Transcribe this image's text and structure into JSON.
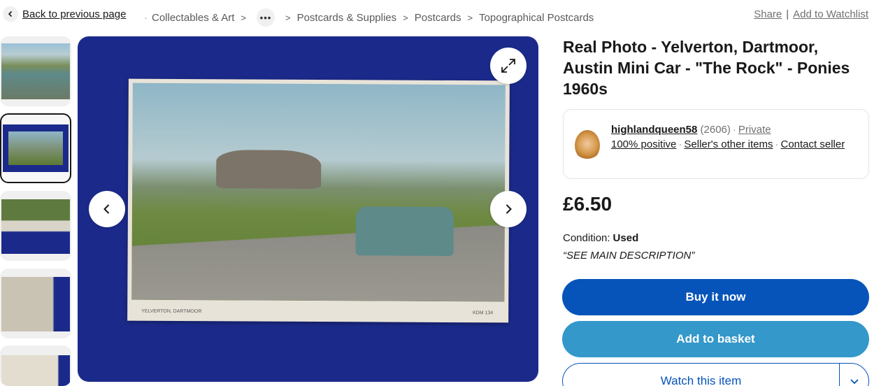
{
  "breadcrumb": {
    "back_label": "Back to previous page",
    "items": [
      "Collectables & Art",
      "Postcards & Supplies",
      "Postcards",
      "Topographical Postcards"
    ],
    "more_label": "•••"
  },
  "top_actions": {
    "share": "Share",
    "watchlist": "Add to Watchlist",
    "separator": "|"
  },
  "gallery": {
    "postcard_caption": "YELVERTON, DARTMOOR",
    "postcard_code": "KDM 134"
  },
  "listing": {
    "title": "Real Photo - Yelverton, Dartmoor, Austin Mini Car - \"The Rock\" - Ponies 1960s",
    "seller": {
      "name": "highlandqueen58",
      "feedback_count": "(2606)",
      "type": "Private",
      "positive": "100% positive",
      "other_items": "Seller's other items",
      "contact": "Contact seller"
    },
    "price": "£6.50",
    "condition_label": "Condition:",
    "condition_value": "Used",
    "condition_desc": "“SEE MAIN DESCRIPTION”"
  },
  "buttons": {
    "buy": "Buy it now",
    "basket": "Add to basket",
    "watch": "Watch this item"
  },
  "colors": {
    "primary": "#0654ba",
    "secondary": "#3498ca"
  }
}
